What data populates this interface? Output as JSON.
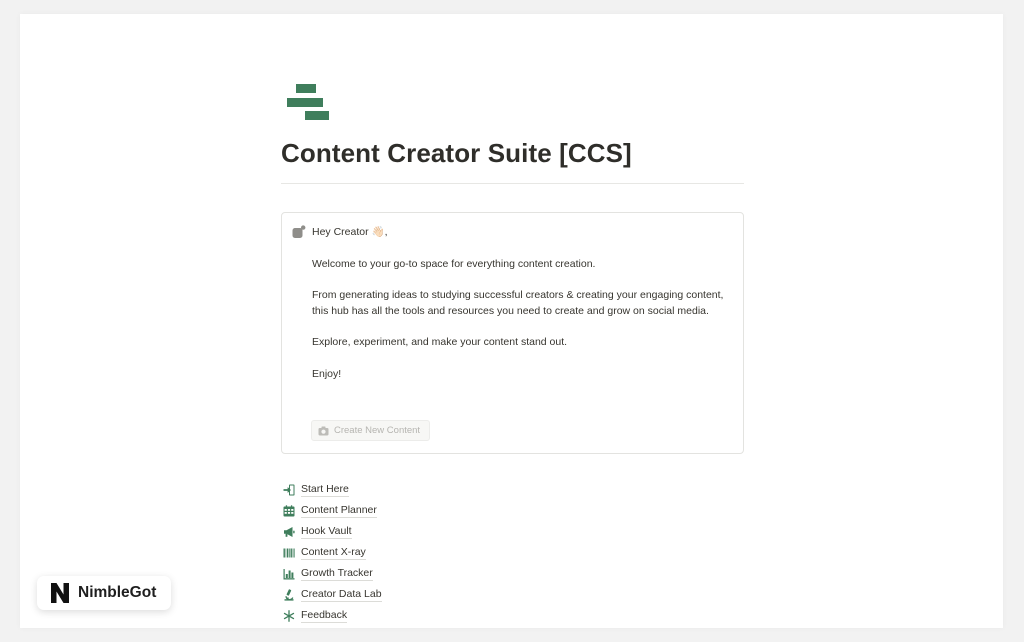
{
  "page": {
    "title": "Content Creator Suite [CCS]",
    "icon": "stacked-bars-icon",
    "accent_color": "#3f7e5c"
  },
  "callout": {
    "icon": "thought-bubble-icon",
    "greeting": "Hey Creator 👋🏻,",
    "paragraphs": [
      "Welcome to your go-to space for everything content creation.",
      "From generating ideas to studying successful creators & creating your engaging content, this hub has all the tools and resources you need to create and grow on social media.",
      "Explore, experiment, and make your content stand out.",
      "Enjoy!"
    ],
    "button": {
      "label": "Create New Content",
      "icon": "camera-icon"
    }
  },
  "nav": {
    "items": [
      {
        "label": "Start Here",
        "icon": "sign-in-icon"
      },
      {
        "label": "Content Planner",
        "icon": "calendar-icon"
      },
      {
        "label": "Hook Vault",
        "icon": "megaphone-icon"
      },
      {
        "label": "Content X-ray",
        "icon": "barcode-icon"
      },
      {
        "label": "Growth Tracker",
        "icon": "bar-chart-icon"
      },
      {
        "label": "Creator Data Lab",
        "icon": "microscope-icon"
      },
      {
        "label": "Feedback",
        "icon": "asterisk-icon"
      }
    ]
  },
  "badge": {
    "brand": "NimbleGot",
    "logo": "n-logo-icon"
  }
}
